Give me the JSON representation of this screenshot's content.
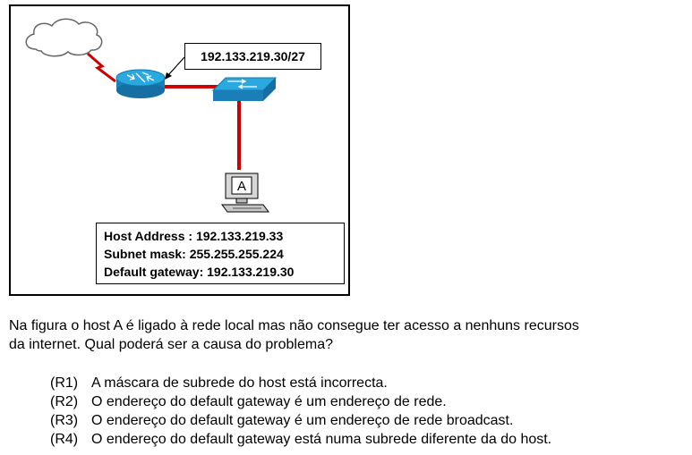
{
  "diagram": {
    "network_label": "192.133.219.30/27",
    "host_letter": "A",
    "host_info": [
      "Host Address : 192.133.219.33",
      "Subnet mask: 255.255.255.224",
      "Default gateway: 192.133.219.30"
    ],
    "colors": {
      "link": "#cc0000",
      "device": "#1e9bd7",
      "cloud_border": "#666666"
    },
    "icons": [
      "cloud-icon",
      "router-icon",
      "switch-icon",
      "host-pc-icon"
    ]
  },
  "question": {
    "line1": "Na figura o host A é ligado à rede local mas não consegue ter acesso a nenhuns recursos",
    "line2": "da internet. Qual poderá ser a causa do problema?"
  },
  "options": [
    {
      "id": "(R1)",
      "text": "A máscara de subrede do host está incorrecta."
    },
    {
      "id": "(R2)",
      "text": "O endereço do default gateway é um endereço de rede."
    },
    {
      "id": "(R3)",
      "text": "O endereço do default gateway é um endereço de rede broadcast."
    },
    {
      "id": "(R4)",
      "text": "O endereço do default gateway está numa subrede diferente da do host."
    }
  ]
}
